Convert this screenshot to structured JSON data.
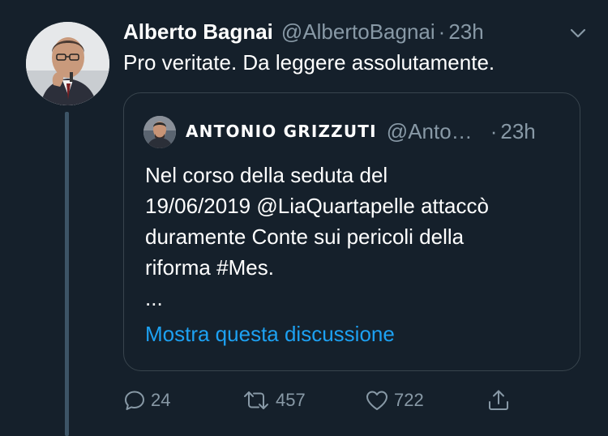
{
  "tweet": {
    "display_name": "Alberto Bagnai",
    "handle": "@AlbertoBagnai",
    "separator": "·",
    "time": "23h",
    "text": "Pro veritate. Da leggere assolutamente."
  },
  "quote": {
    "display_name": "ANTONIO GRIZZUTI",
    "handle": "@Anto…",
    "separator": "·",
    "time": "23h",
    "lines": [
      "Nel corso della seduta del",
      "19/06/2019 @LiaQuartapelle attaccò",
      "duramente Conte sui pericoli della",
      "riforma #Mes.",
      "..."
    ],
    "link_text": "Mostra questa discussione"
  },
  "actions": {
    "replies": "24",
    "retweets": "457",
    "likes": "722"
  },
  "colors": {
    "background": "#15202b",
    "secondary_text": "#8899a6",
    "link": "#1da1f2",
    "border": "#38444d"
  },
  "icons": {
    "caret": "chevron-down-icon",
    "reply": "reply-icon",
    "retweet": "retweet-icon",
    "like": "heart-icon",
    "share": "share-icon"
  }
}
